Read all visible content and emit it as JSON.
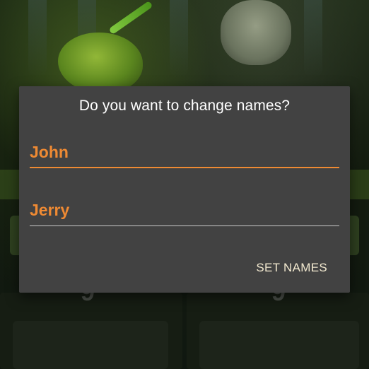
{
  "dialog": {
    "title": "Do you want to change names?",
    "first_name": {
      "value": "John",
      "placeholder": ""
    },
    "second_name": {
      "value": "Jerry",
      "placeholder": ""
    },
    "confirm_label": "SET NAMES"
  },
  "background": {
    "left_digit": "9",
    "right_digit": "9"
  },
  "colors": {
    "accent": "#ef8a33",
    "dialog_bg": "#424242",
    "button_text": "#f3ead0"
  }
}
